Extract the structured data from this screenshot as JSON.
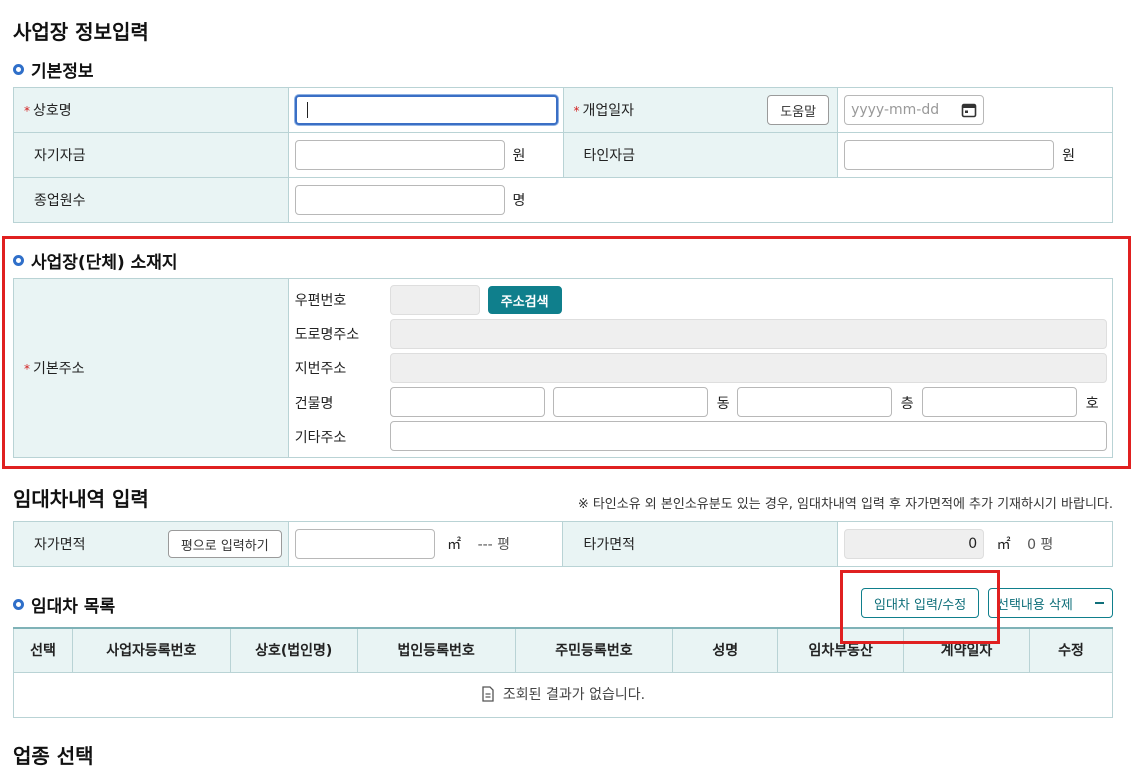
{
  "page_title": "사업장 정보입력",
  "basic": {
    "title": "기본정보",
    "trade_name_label": "상호명",
    "opening_date_label": "개업일자",
    "help_button": "도움말",
    "date_placeholder": "yyyy-mm-dd",
    "own_capital_label": "자기자금",
    "other_capital_label": "타인자금",
    "won_unit": "원",
    "employees_label": "종업원수",
    "person_unit": "명"
  },
  "location": {
    "title": "사업장(단체) 소재지",
    "base_address_label": "기본주소",
    "postcode_label": "우편번호",
    "address_search_button": "주소검색",
    "road_address_label": "도로명주소",
    "lot_address_label": "지번주소",
    "building_label": "건물명",
    "dong_unit": "동",
    "floor_unit": "층",
    "ho_unit": "호",
    "other_address_label": "기타주소"
  },
  "lease_input": {
    "title": "임대차내역 입력",
    "note": "※ 타인소유 외 본인소유분도 있는 경우, 임대차내역 입력 후 자가면적에 추가 기재하시기 바랍니다.",
    "own_area_label": "자가면적",
    "pyeong_button": "평으로 입력하기",
    "sqm_unit": "㎡",
    "own_pyeong": "--- 평",
    "other_area_label": "타가면적",
    "other_area_value": "0",
    "other_pyeong": "0 평"
  },
  "lease_list": {
    "title": "임대차 목록",
    "edit_button": "임대차 입력/수정",
    "delete_button": "선택내용 삭제",
    "columns": [
      "선택",
      "사업자등록번호",
      "상호(법인명)",
      "법인등록번호",
      "주민등록번호",
      "성명",
      "임차부동산",
      "계약일자",
      "수정"
    ],
    "empty_message": "조회된 결과가 없습니다."
  },
  "industry": {
    "title": "업종 선택"
  },
  "colors": {
    "accent": "#0f7f8c",
    "header_bg": "#e9f4f4",
    "highlight": "#e02020",
    "required": "#d21d1d"
  }
}
